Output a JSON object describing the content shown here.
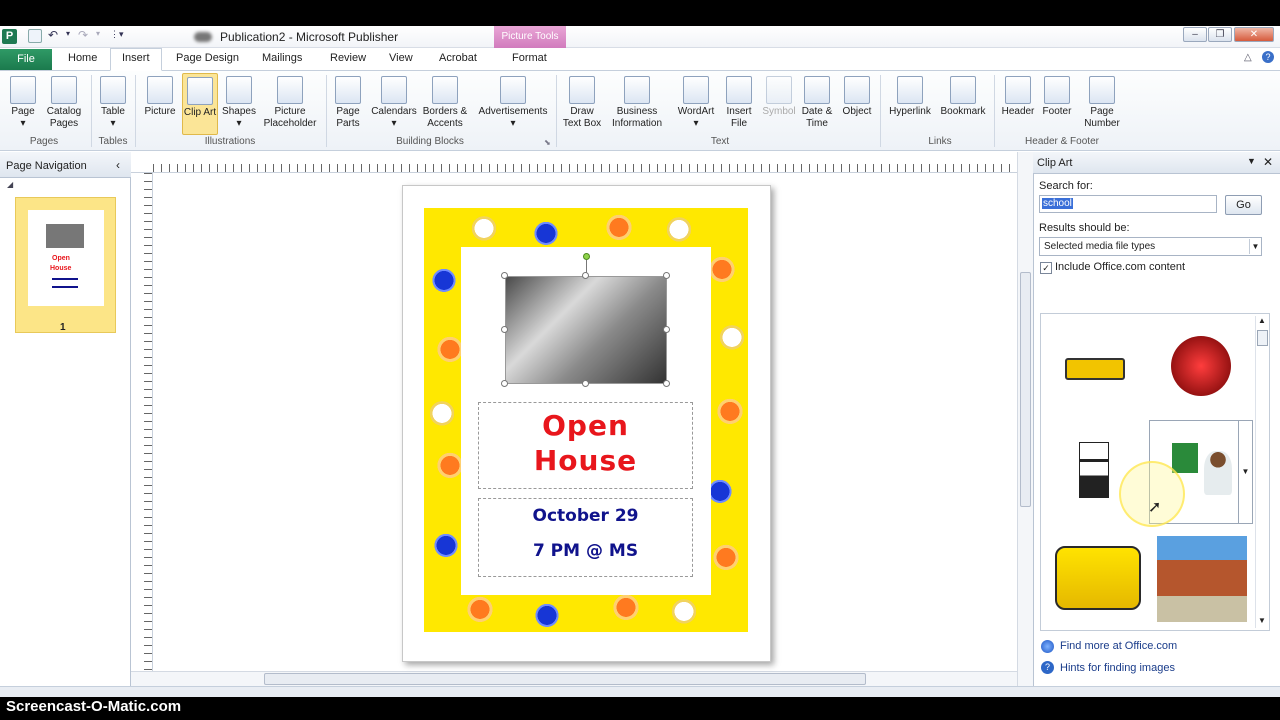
{
  "window": {
    "title": "Publication2 - Microsoft Publisher",
    "app_letter": "P",
    "context_tab": "Picture Tools",
    "controls": {
      "minimize": "–",
      "restore": "❐",
      "close": "✕"
    }
  },
  "tabs": {
    "file": "File",
    "items": [
      "Home",
      "Insert",
      "Page Design",
      "Mailings",
      "Review",
      "View",
      "Acrobat",
      "Format"
    ],
    "active": "Insert"
  },
  "ribbon": {
    "buttons": [
      {
        "label": "Page",
        "icon": "page-icon"
      },
      {
        "label": "Catalog Pages",
        "icon": "catalog-pages-icon"
      },
      {
        "label": "Table",
        "icon": "table-icon"
      },
      {
        "label": "Picture",
        "icon": "picture-icon"
      },
      {
        "label": "Clip Art",
        "icon": "clip-art-icon",
        "selected": true
      },
      {
        "label": "Shapes",
        "icon": "shapes-icon"
      },
      {
        "label": "Picture Placeholder",
        "icon": "picture-placeholder-icon"
      },
      {
        "label": "Page Parts",
        "icon": "page-parts-icon"
      },
      {
        "label": "Calendars",
        "icon": "calendars-icon"
      },
      {
        "label": "Borders & Accents",
        "icon": "borders-accents-icon"
      },
      {
        "label": "Advertisements",
        "icon": "advertisements-icon"
      },
      {
        "label": "Draw Text Box",
        "icon": "draw-text-box-icon"
      },
      {
        "label": "Business Information",
        "icon": "business-information-icon"
      },
      {
        "label": "WordArt",
        "icon": "wordart-icon"
      },
      {
        "label": "Insert File",
        "icon": "insert-file-icon"
      },
      {
        "label": "Symbol",
        "icon": "symbol-icon",
        "disabled": true
      },
      {
        "label": "Date & Time",
        "icon": "date-time-icon"
      },
      {
        "label": "Object",
        "icon": "object-icon"
      },
      {
        "label": "Hyperlink",
        "icon": "hyperlink-icon"
      },
      {
        "label": "Bookmark",
        "icon": "bookmark-icon"
      },
      {
        "label": "Header",
        "icon": "header-icon"
      },
      {
        "label": "Footer",
        "icon": "footer-icon"
      },
      {
        "label": "Page Number",
        "icon": "page-number-icon"
      }
    ],
    "groups": [
      "Pages",
      "Tables",
      "Illustrations",
      "Building Blocks",
      "Text",
      "Links",
      "Header & Footer"
    ]
  },
  "nav": {
    "title": "Page Navigation",
    "collapse": "‹",
    "page_number": "1"
  },
  "document": {
    "heading_line1": "Open",
    "heading_line2": "House",
    "date": "October 29",
    "time": "7 PM @ MS"
  },
  "clipart": {
    "title": "Clip Art",
    "search_label": "Search for:",
    "search_value": "school",
    "go_label": "Go",
    "results_label": "Results should be:",
    "results_value": "Selected media file types",
    "include_label": "Include Office.com content",
    "include_checked": true,
    "find_more": "Find more at Office.com",
    "hints": "Hints for finding images"
  },
  "watermark": "Screencast-O-Matic.com",
  "colors": {
    "file_tab": "#1b7a4d",
    "context_tab": "#d17bbd",
    "border_yellow": "#ffe800",
    "heading_red": "#e8161c",
    "date_blue": "#10138c"
  }
}
